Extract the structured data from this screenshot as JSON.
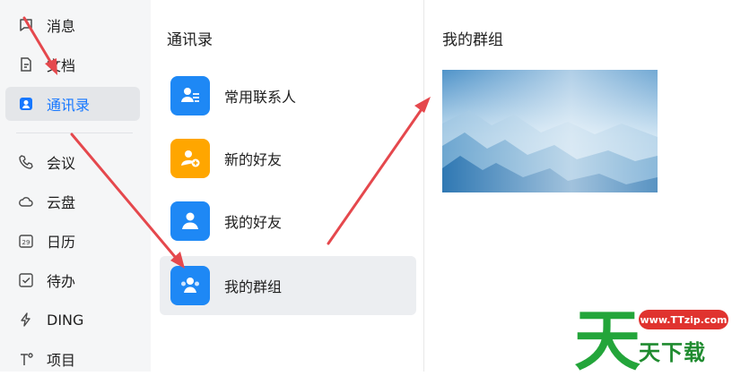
{
  "sidebar": {
    "items": [
      {
        "label": "消息",
        "icon": "message-icon"
      },
      {
        "label": "文档",
        "icon": "document-icon"
      },
      {
        "label": "通讯录",
        "icon": "contacts-icon",
        "active": true
      },
      {
        "label": "会议",
        "icon": "phone-icon"
      },
      {
        "label": "云盘",
        "icon": "cloud-icon"
      },
      {
        "label": "日历",
        "icon": "calendar-icon",
        "icon_text": "29"
      },
      {
        "label": "待办",
        "icon": "checkbox-icon"
      },
      {
        "label": "DING",
        "icon": "lightning-icon"
      },
      {
        "label": "项目",
        "icon": "project-icon"
      }
    ]
  },
  "contacts": {
    "title": "通讯录",
    "items": [
      {
        "label": "常用联系人",
        "color": "#1e88f5"
      },
      {
        "label": "新的好友",
        "color": "#ffa600"
      },
      {
        "label": "我的好友",
        "color": "#1e88f5"
      },
      {
        "label": "我的群组",
        "color": "#1e88f5",
        "selected": true
      }
    ]
  },
  "detail": {
    "title": "我的群组"
  },
  "watermark": {
    "url": "www.TTzip.com",
    "text": "天下载",
    "logo_char": "天"
  },
  "colors": {
    "accent": "#1677ff",
    "annotation": "#e5484d"
  }
}
